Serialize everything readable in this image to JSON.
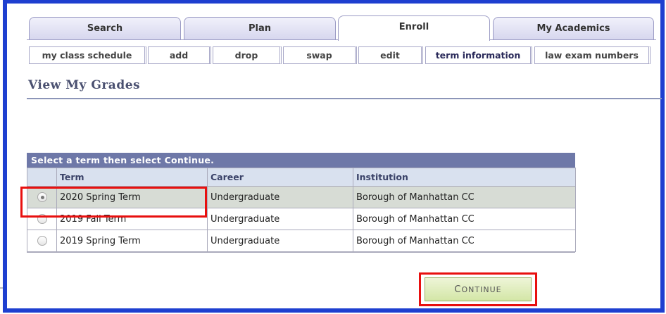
{
  "main_tabs": [
    {
      "label": "Search"
    },
    {
      "label": "Plan"
    },
    {
      "label": "Enroll"
    },
    {
      "label": "My Academics"
    }
  ],
  "sub_tabs": [
    {
      "label": "my class schedule"
    },
    {
      "label": "add"
    },
    {
      "label": "drop"
    },
    {
      "label": "swap"
    },
    {
      "label": "edit"
    },
    {
      "label": "term information"
    },
    {
      "label": "law exam numbers"
    }
  ],
  "page_title": "View My Grades",
  "grid": {
    "caption": "Select a term then select Continue.",
    "headers": {
      "term": "Term",
      "career": "Career",
      "institution": "Institution"
    },
    "rows": [
      {
        "term": "2020 Spring Term",
        "career": "Undergraduate",
        "institution": "Borough of Manhattan CC",
        "selected": true
      },
      {
        "term": "2019 Fall Term",
        "career": "Undergraduate",
        "institution": "Borough of Manhattan CC",
        "selected": false
      },
      {
        "term": "2019 Spring Term",
        "career": "Undergraduate",
        "institution": "Borough of Manhattan CC",
        "selected": false
      }
    ]
  },
  "continue_button": {
    "first": "C",
    "rest": "ONTINUE"
  },
  "colors": {
    "frame_border": "#1e3fd0",
    "grid_caption_bg": "#6e78a8",
    "highlight": "#e8100f",
    "button_bg": "#d3e6a6"
  }
}
